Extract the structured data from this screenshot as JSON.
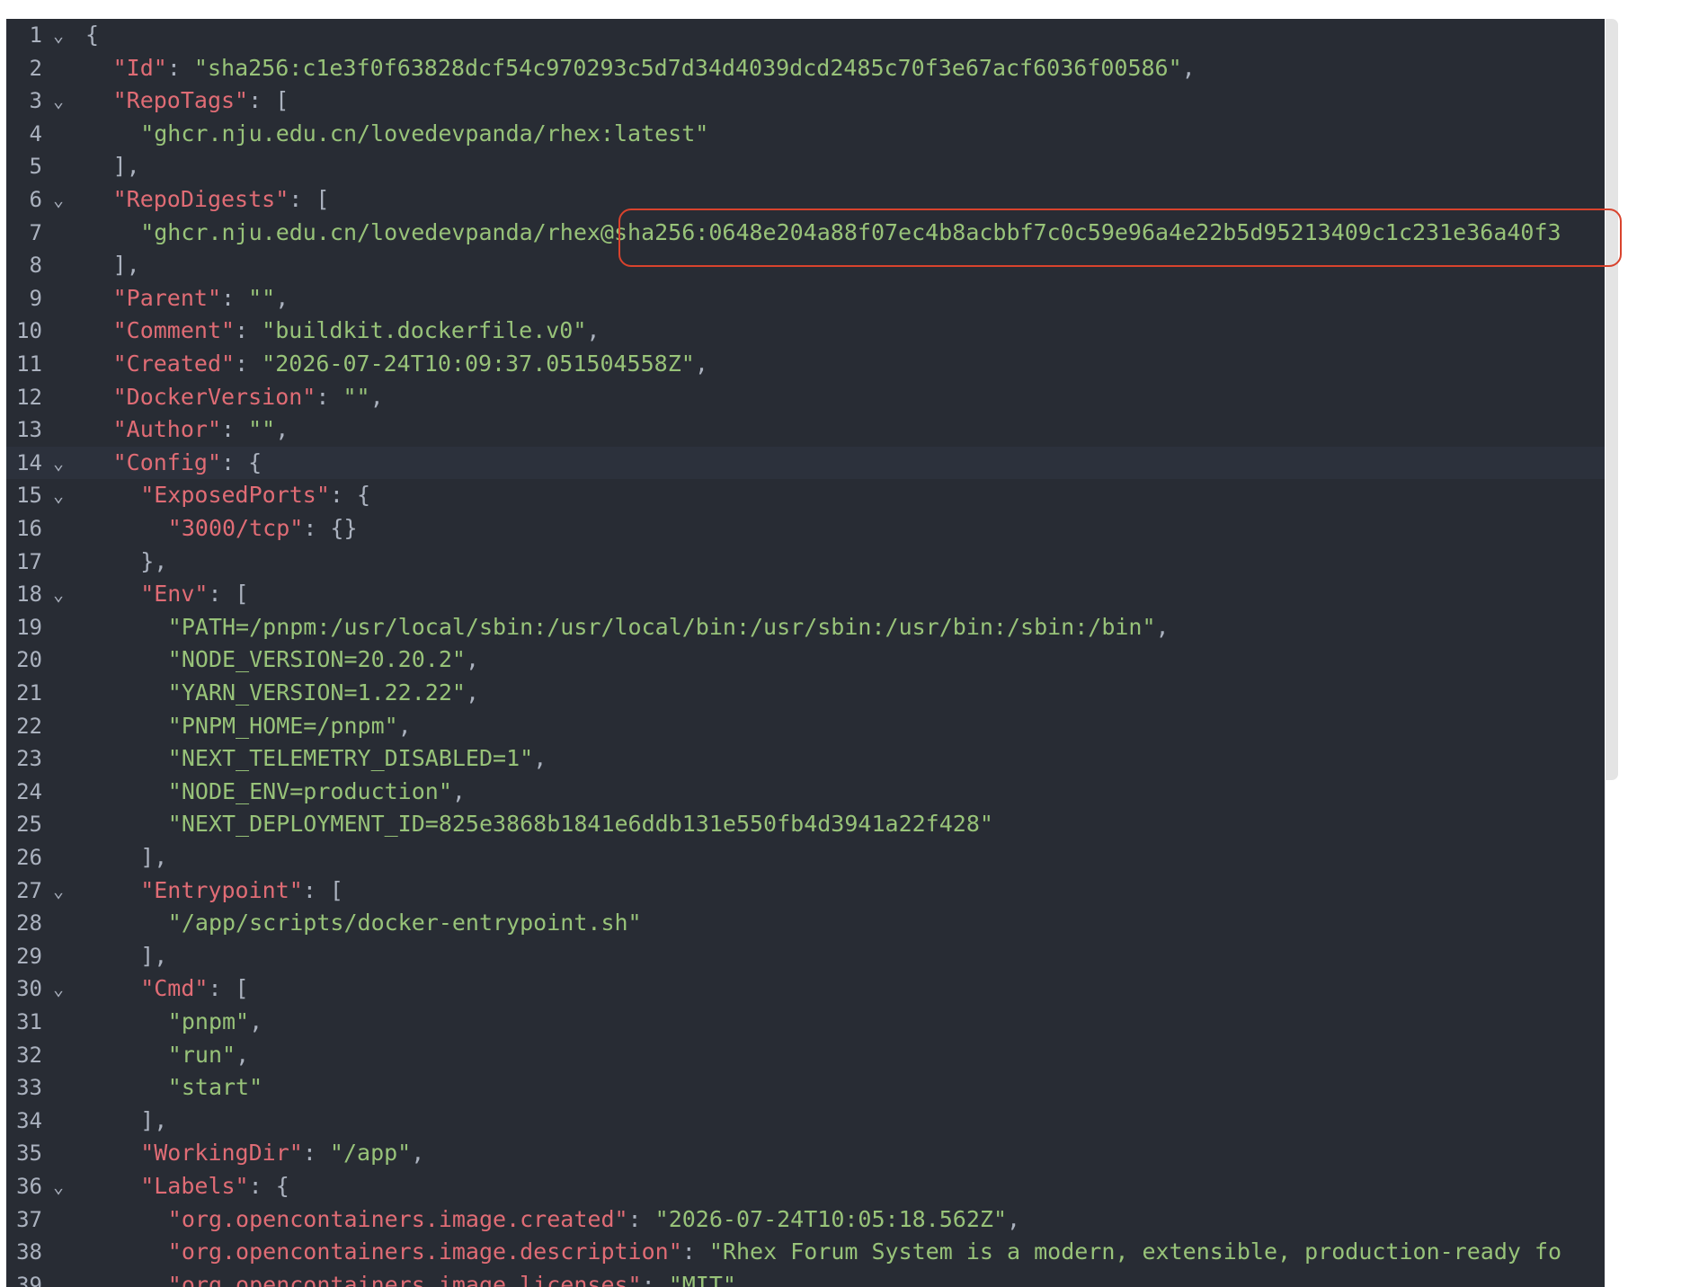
{
  "lines": [
    {
      "n": "1",
      "fold": true,
      "indent": 0,
      "parts": [
        {
          "t": "{",
          "c": "p"
        }
      ]
    },
    {
      "n": "2",
      "fold": false,
      "indent": 1,
      "parts": [
        {
          "t": "\"Id\"",
          "c": "k"
        },
        {
          "t": ": ",
          "c": "p"
        },
        {
          "t": "\"sha256:c1e3f0f63828dcf54c970293c5d7d34d4039dcd2485c70f3e67acf6036f00586\"",
          "c": "s"
        },
        {
          "t": ",",
          "c": "p"
        }
      ]
    },
    {
      "n": "3",
      "fold": true,
      "indent": 1,
      "parts": [
        {
          "t": "\"RepoTags\"",
          "c": "k"
        },
        {
          "t": ": [",
          "c": "p"
        }
      ]
    },
    {
      "n": "4",
      "fold": false,
      "indent": 2,
      "parts": [
        {
          "t": "\"ghcr.nju.edu.cn/lovedevpanda/rhex:latest\"",
          "c": "s"
        }
      ]
    },
    {
      "n": "5",
      "fold": false,
      "indent": 1,
      "parts": [
        {
          "t": "],",
          "c": "p"
        }
      ]
    },
    {
      "n": "6",
      "fold": true,
      "indent": 1,
      "parts": [
        {
          "t": "\"RepoDigests\"",
          "c": "k"
        },
        {
          "t": ": [",
          "c": "p"
        }
      ]
    },
    {
      "n": "7",
      "fold": false,
      "indent": 2,
      "parts": [
        {
          "t": "\"ghcr.nju.edu.cn/lovedevpanda/rhex@sha256:0648e204a88f07ec4b8acbbf7c0c59e96a4e22b5d95213409c1c231e36a40f3",
          "c": "s"
        }
      ]
    },
    {
      "n": "8",
      "fold": false,
      "indent": 1,
      "parts": [
        {
          "t": "],",
          "c": "p"
        }
      ]
    },
    {
      "n": "9",
      "fold": false,
      "indent": 1,
      "parts": [
        {
          "t": "\"Parent\"",
          "c": "k"
        },
        {
          "t": ": ",
          "c": "p"
        },
        {
          "t": "\"\"",
          "c": "s"
        },
        {
          "t": ",",
          "c": "p"
        }
      ]
    },
    {
      "n": "10",
      "fold": false,
      "indent": 1,
      "parts": [
        {
          "t": "\"Comment\"",
          "c": "k"
        },
        {
          "t": ": ",
          "c": "p"
        },
        {
          "t": "\"buildkit.dockerfile.v0\"",
          "c": "s"
        },
        {
          "t": ",",
          "c": "p"
        }
      ]
    },
    {
      "n": "11",
      "fold": false,
      "indent": 1,
      "parts": [
        {
          "t": "\"Created\"",
          "c": "k"
        },
        {
          "t": ": ",
          "c": "p"
        },
        {
          "t": "\"2026-07-24T10:09:37.051504558Z\"",
          "c": "s"
        },
        {
          "t": ",",
          "c": "p"
        }
      ]
    },
    {
      "n": "12",
      "fold": false,
      "indent": 1,
      "parts": [
        {
          "t": "\"DockerVersion\"",
          "c": "k"
        },
        {
          "t": ": ",
          "c": "p"
        },
        {
          "t": "\"\"",
          "c": "s"
        },
        {
          "t": ",",
          "c": "p"
        }
      ]
    },
    {
      "n": "13",
      "fold": false,
      "indent": 1,
      "parts": [
        {
          "t": "\"Author\"",
          "c": "k"
        },
        {
          "t": ": ",
          "c": "p"
        },
        {
          "t": "\"\"",
          "c": "s"
        },
        {
          "t": ",",
          "c": "p"
        }
      ]
    },
    {
      "n": "14",
      "fold": true,
      "indent": 1,
      "active": true,
      "parts": [
        {
          "t": "\"Config\"",
          "c": "k"
        },
        {
          "t": ": {",
          "c": "p"
        }
      ]
    },
    {
      "n": "15",
      "fold": true,
      "indent": 2,
      "parts": [
        {
          "t": "\"ExposedPorts\"",
          "c": "k"
        },
        {
          "t": ": {",
          "c": "p"
        }
      ]
    },
    {
      "n": "16",
      "fold": false,
      "indent": 3,
      "parts": [
        {
          "t": "\"3000/tcp\"",
          "c": "k"
        },
        {
          "t": ": {}",
          "c": "p"
        }
      ]
    },
    {
      "n": "17",
      "fold": false,
      "indent": 2,
      "parts": [
        {
          "t": "},",
          "c": "p"
        }
      ]
    },
    {
      "n": "18",
      "fold": true,
      "indent": 2,
      "parts": [
        {
          "t": "\"Env\"",
          "c": "k"
        },
        {
          "t": ": [",
          "c": "p"
        }
      ]
    },
    {
      "n": "19",
      "fold": false,
      "indent": 3,
      "parts": [
        {
          "t": "\"PATH=/pnpm:/usr/local/sbin:/usr/local/bin:/usr/sbin:/usr/bin:/sbin:/bin\"",
          "c": "s"
        },
        {
          "t": ",",
          "c": "p"
        }
      ]
    },
    {
      "n": "20",
      "fold": false,
      "indent": 3,
      "parts": [
        {
          "t": "\"NODE_VERSION=20.20.2\"",
          "c": "s"
        },
        {
          "t": ",",
          "c": "p"
        }
      ]
    },
    {
      "n": "21",
      "fold": false,
      "indent": 3,
      "parts": [
        {
          "t": "\"YARN_VERSION=1.22.22\"",
          "c": "s"
        },
        {
          "t": ",",
          "c": "p"
        }
      ]
    },
    {
      "n": "22",
      "fold": false,
      "indent": 3,
      "parts": [
        {
          "t": "\"PNPM_HOME=/pnpm\"",
          "c": "s"
        },
        {
          "t": ",",
          "c": "p"
        }
      ]
    },
    {
      "n": "23",
      "fold": false,
      "indent": 3,
      "parts": [
        {
          "t": "\"NEXT_TELEMETRY_DISABLED=1\"",
          "c": "s"
        },
        {
          "t": ",",
          "c": "p"
        }
      ]
    },
    {
      "n": "24",
      "fold": false,
      "indent": 3,
      "parts": [
        {
          "t": "\"NODE_ENV=production\"",
          "c": "s"
        },
        {
          "t": ",",
          "c": "p"
        }
      ]
    },
    {
      "n": "25",
      "fold": false,
      "indent": 3,
      "parts": [
        {
          "t": "\"NEXT_DEPLOYMENT_ID=825e3868b1841e6ddb131e550fb4d3941a22f428\"",
          "c": "s"
        }
      ]
    },
    {
      "n": "26",
      "fold": false,
      "indent": 2,
      "parts": [
        {
          "t": "],",
          "c": "p"
        }
      ]
    },
    {
      "n": "27",
      "fold": true,
      "indent": 2,
      "parts": [
        {
          "t": "\"Entrypoint\"",
          "c": "k"
        },
        {
          "t": ": [",
          "c": "p"
        }
      ]
    },
    {
      "n": "28",
      "fold": false,
      "indent": 3,
      "parts": [
        {
          "t": "\"/app/scripts/docker-entrypoint.sh\"",
          "c": "s"
        }
      ]
    },
    {
      "n": "29",
      "fold": false,
      "indent": 2,
      "parts": [
        {
          "t": "],",
          "c": "p"
        }
      ]
    },
    {
      "n": "30",
      "fold": true,
      "indent": 2,
      "parts": [
        {
          "t": "\"Cmd\"",
          "c": "k"
        },
        {
          "t": ": [",
          "c": "p"
        }
      ]
    },
    {
      "n": "31",
      "fold": false,
      "indent": 3,
      "parts": [
        {
          "t": "\"pnpm\"",
          "c": "s"
        },
        {
          "t": ",",
          "c": "p"
        }
      ]
    },
    {
      "n": "32",
      "fold": false,
      "indent": 3,
      "parts": [
        {
          "t": "\"run\"",
          "c": "s"
        },
        {
          "t": ",",
          "c": "p"
        }
      ]
    },
    {
      "n": "33",
      "fold": false,
      "indent": 3,
      "parts": [
        {
          "t": "\"start\"",
          "c": "s"
        }
      ]
    },
    {
      "n": "34",
      "fold": false,
      "indent": 2,
      "parts": [
        {
          "t": "],",
          "c": "p"
        }
      ]
    },
    {
      "n": "35",
      "fold": false,
      "indent": 2,
      "parts": [
        {
          "t": "\"WorkingDir\"",
          "c": "k"
        },
        {
          "t": ": ",
          "c": "p"
        },
        {
          "t": "\"/app\"",
          "c": "s"
        },
        {
          "t": ",",
          "c": "p"
        }
      ]
    },
    {
      "n": "36",
      "fold": true,
      "indent": 2,
      "parts": [
        {
          "t": "\"Labels\"",
          "c": "k"
        },
        {
          "t": ": {",
          "c": "p"
        }
      ]
    },
    {
      "n": "37",
      "fold": false,
      "indent": 3,
      "parts": [
        {
          "t": "\"org.opencontainers.image.created\"",
          "c": "k"
        },
        {
          "t": ": ",
          "c": "p"
        },
        {
          "t": "\"2026-07-24T10:05:18.562Z\"",
          "c": "s"
        },
        {
          "t": ",",
          "c": "p"
        }
      ]
    },
    {
      "n": "38",
      "fold": false,
      "indent": 3,
      "parts": [
        {
          "t": "\"org.opencontainers.image.description\"",
          "c": "k"
        },
        {
          "t": ": ",
          "c": "p"
        },
        {
          "t": "\"Rhex Forum System is a modern, extensible, production-ready fo",
          "c": "s"
        }
      ]
    },
    {
      "n": "39",
      "fold": false,
      "indent": 3,
      "parts": [
        {
          "t": "\"org.opencontainers.image.licenses\"",
          "c": "k"
        },
        {
          "t": ": ",
          "c": "p"
        },
        {
          "t": "\"MIT\"",
          "c": "s"
        }
      ]
    }
  ],
  "fold_glyph": "⌄",
  "colors": {
    "background": "#282c34",
    "key": "#e06c75",
    "string": "#98c379",
    "punctuation": "#abb2bf",
    "highlight_box": "#d9432d"
  }
}
